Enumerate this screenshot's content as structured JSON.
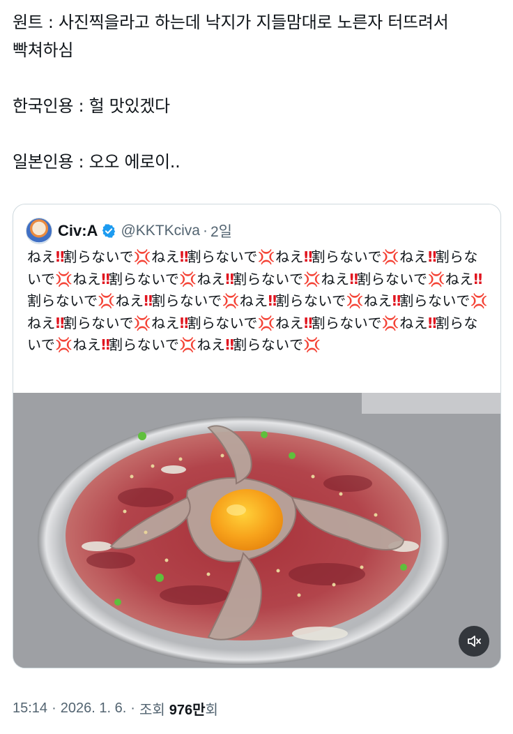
{
  "post": {
    "lines": [
      "원트 : 사진찍을라고 하는데 낙지가 지들맘대로 노른자 터뜨려서",
      "빡쳐하심",
      "",
      "한국인용 : 헐 맛있겠다",
      "",
      "일본인용 : 오오 에로이.."
    ]
  },
  "quote": {
    "author_name": "Civ:A",
    "handle": "@KKTKciva",
    "separator": "·",
    "time": "2일",
    "verified_icon": "verified-badge-icon",
    "segments": [
      "ねえ",
      "‼",
      "割らないで",
      "💢",
      "ねえ",
      "‼",
      "割らないで",
      "💢",
      "ねえ",
      "‼",
      "割らないで",
      "💢",
      "ねえ",
      "‼",
      "割らないで",
      "💢",
      "ねえ",
      "‼",
      "割らないで",
      "💢",
      "ねえ",
      "‼",
      "割らないで",
      "💢",
      "ねえ",
      "‼",
      "割らないで",
      "💢",
      "ねえ",
      "‼",
      "割らないで",
      "💢",
      "ねえ",
      "‼",
      "割らないで",
      "💢",
      "ねえ",
      "‼",
      "割らないで",
      "💢",
      "ねえ",
      "‼",
      "割らないで",
      "💢",
      "ねえ",
      "‼",
      "割らないで",
      "💢",
      "ねえ",
      "‼",
      "割らないで",
      "💢",
      "ねえ",
      "‼",
      "割らないで",
      "💢",
      "ねえ",
      "‼",
      "割らないで",
      "💢",
      "ねえ",
      "‼",
      "割らないで",
      "💢",
      "ねえ",
      "‼",
      "割らないで",
      "💢"
    ],
    "media_icon": "muted-speaker-icon"
  },
  "meta": {
    "time": "15:14",
    "sep1": "·",
    "date": "2026. 1. 6.",
    "sep2": "·",
    "views_label": "조회",
    "views_count": "976만",
    "views_suffix": "회"
  },
  "colors": {
    "text": "#0f1419",
    "secondary": "#536471",
    "border": "#cfd9de",
    "verified": "#1d9bf0",
    "egg_yolk": "#f5a623"
  }
}
